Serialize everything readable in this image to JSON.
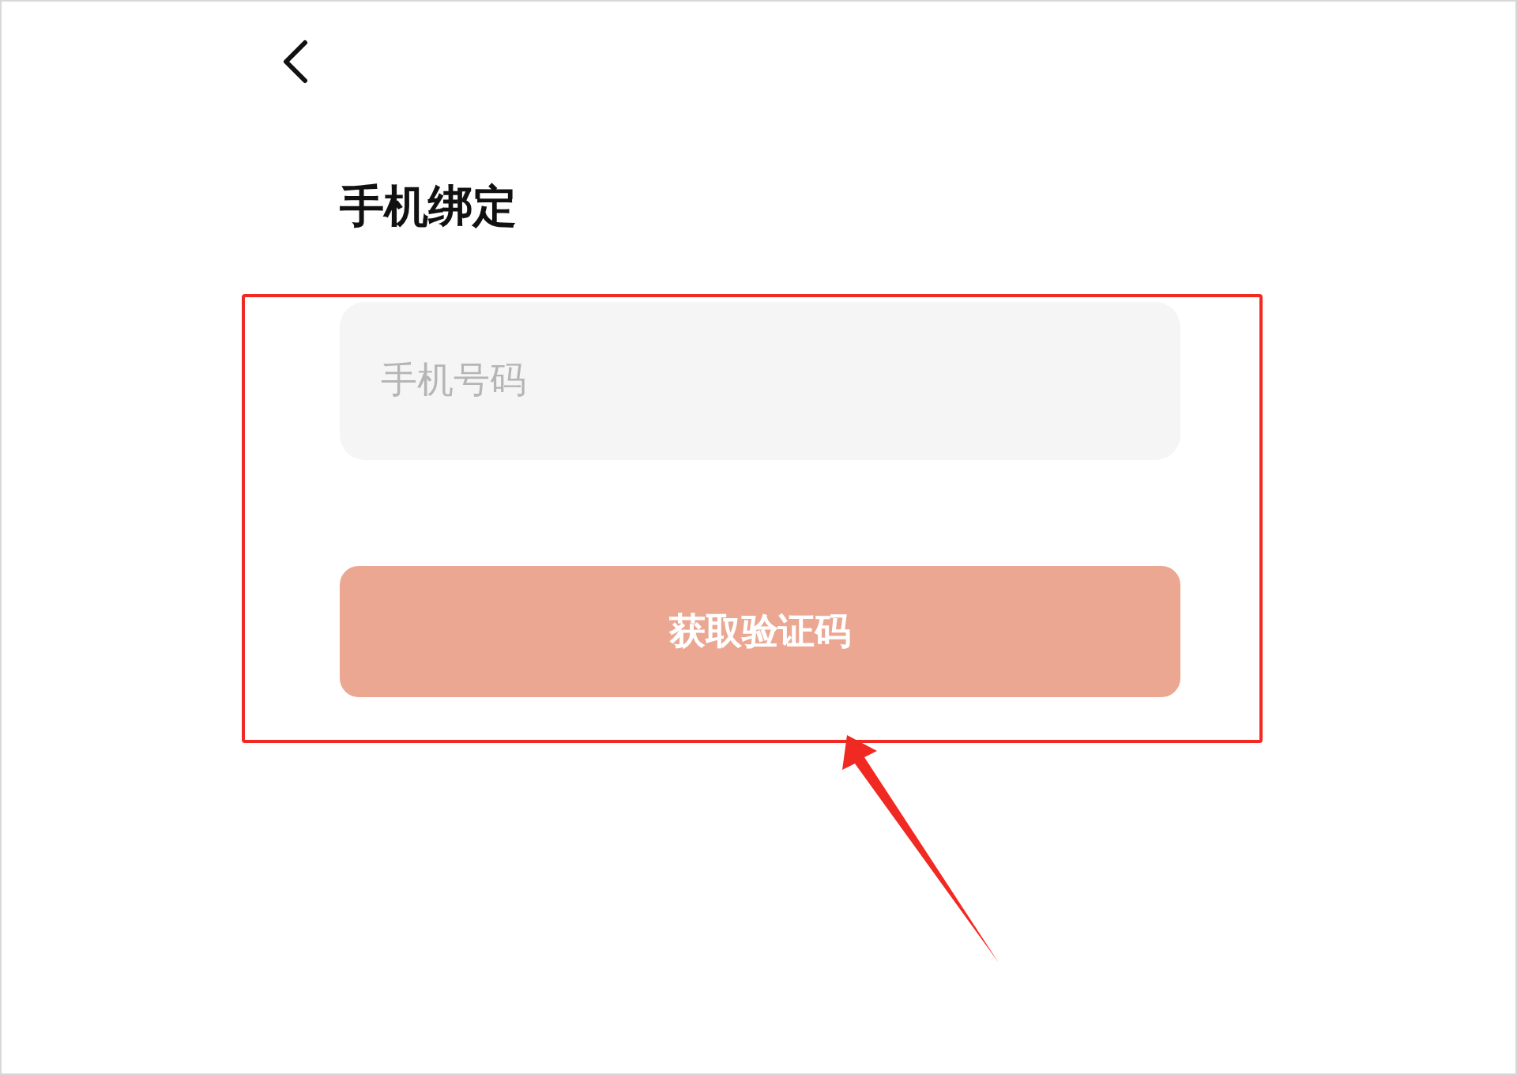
{
  "title": "手机绑定",
  "phone_field": {
    "placeholder": "手机号码"
  },
  "button": {
    "label": "获取验证码",
    "disabled": true
  }
}
